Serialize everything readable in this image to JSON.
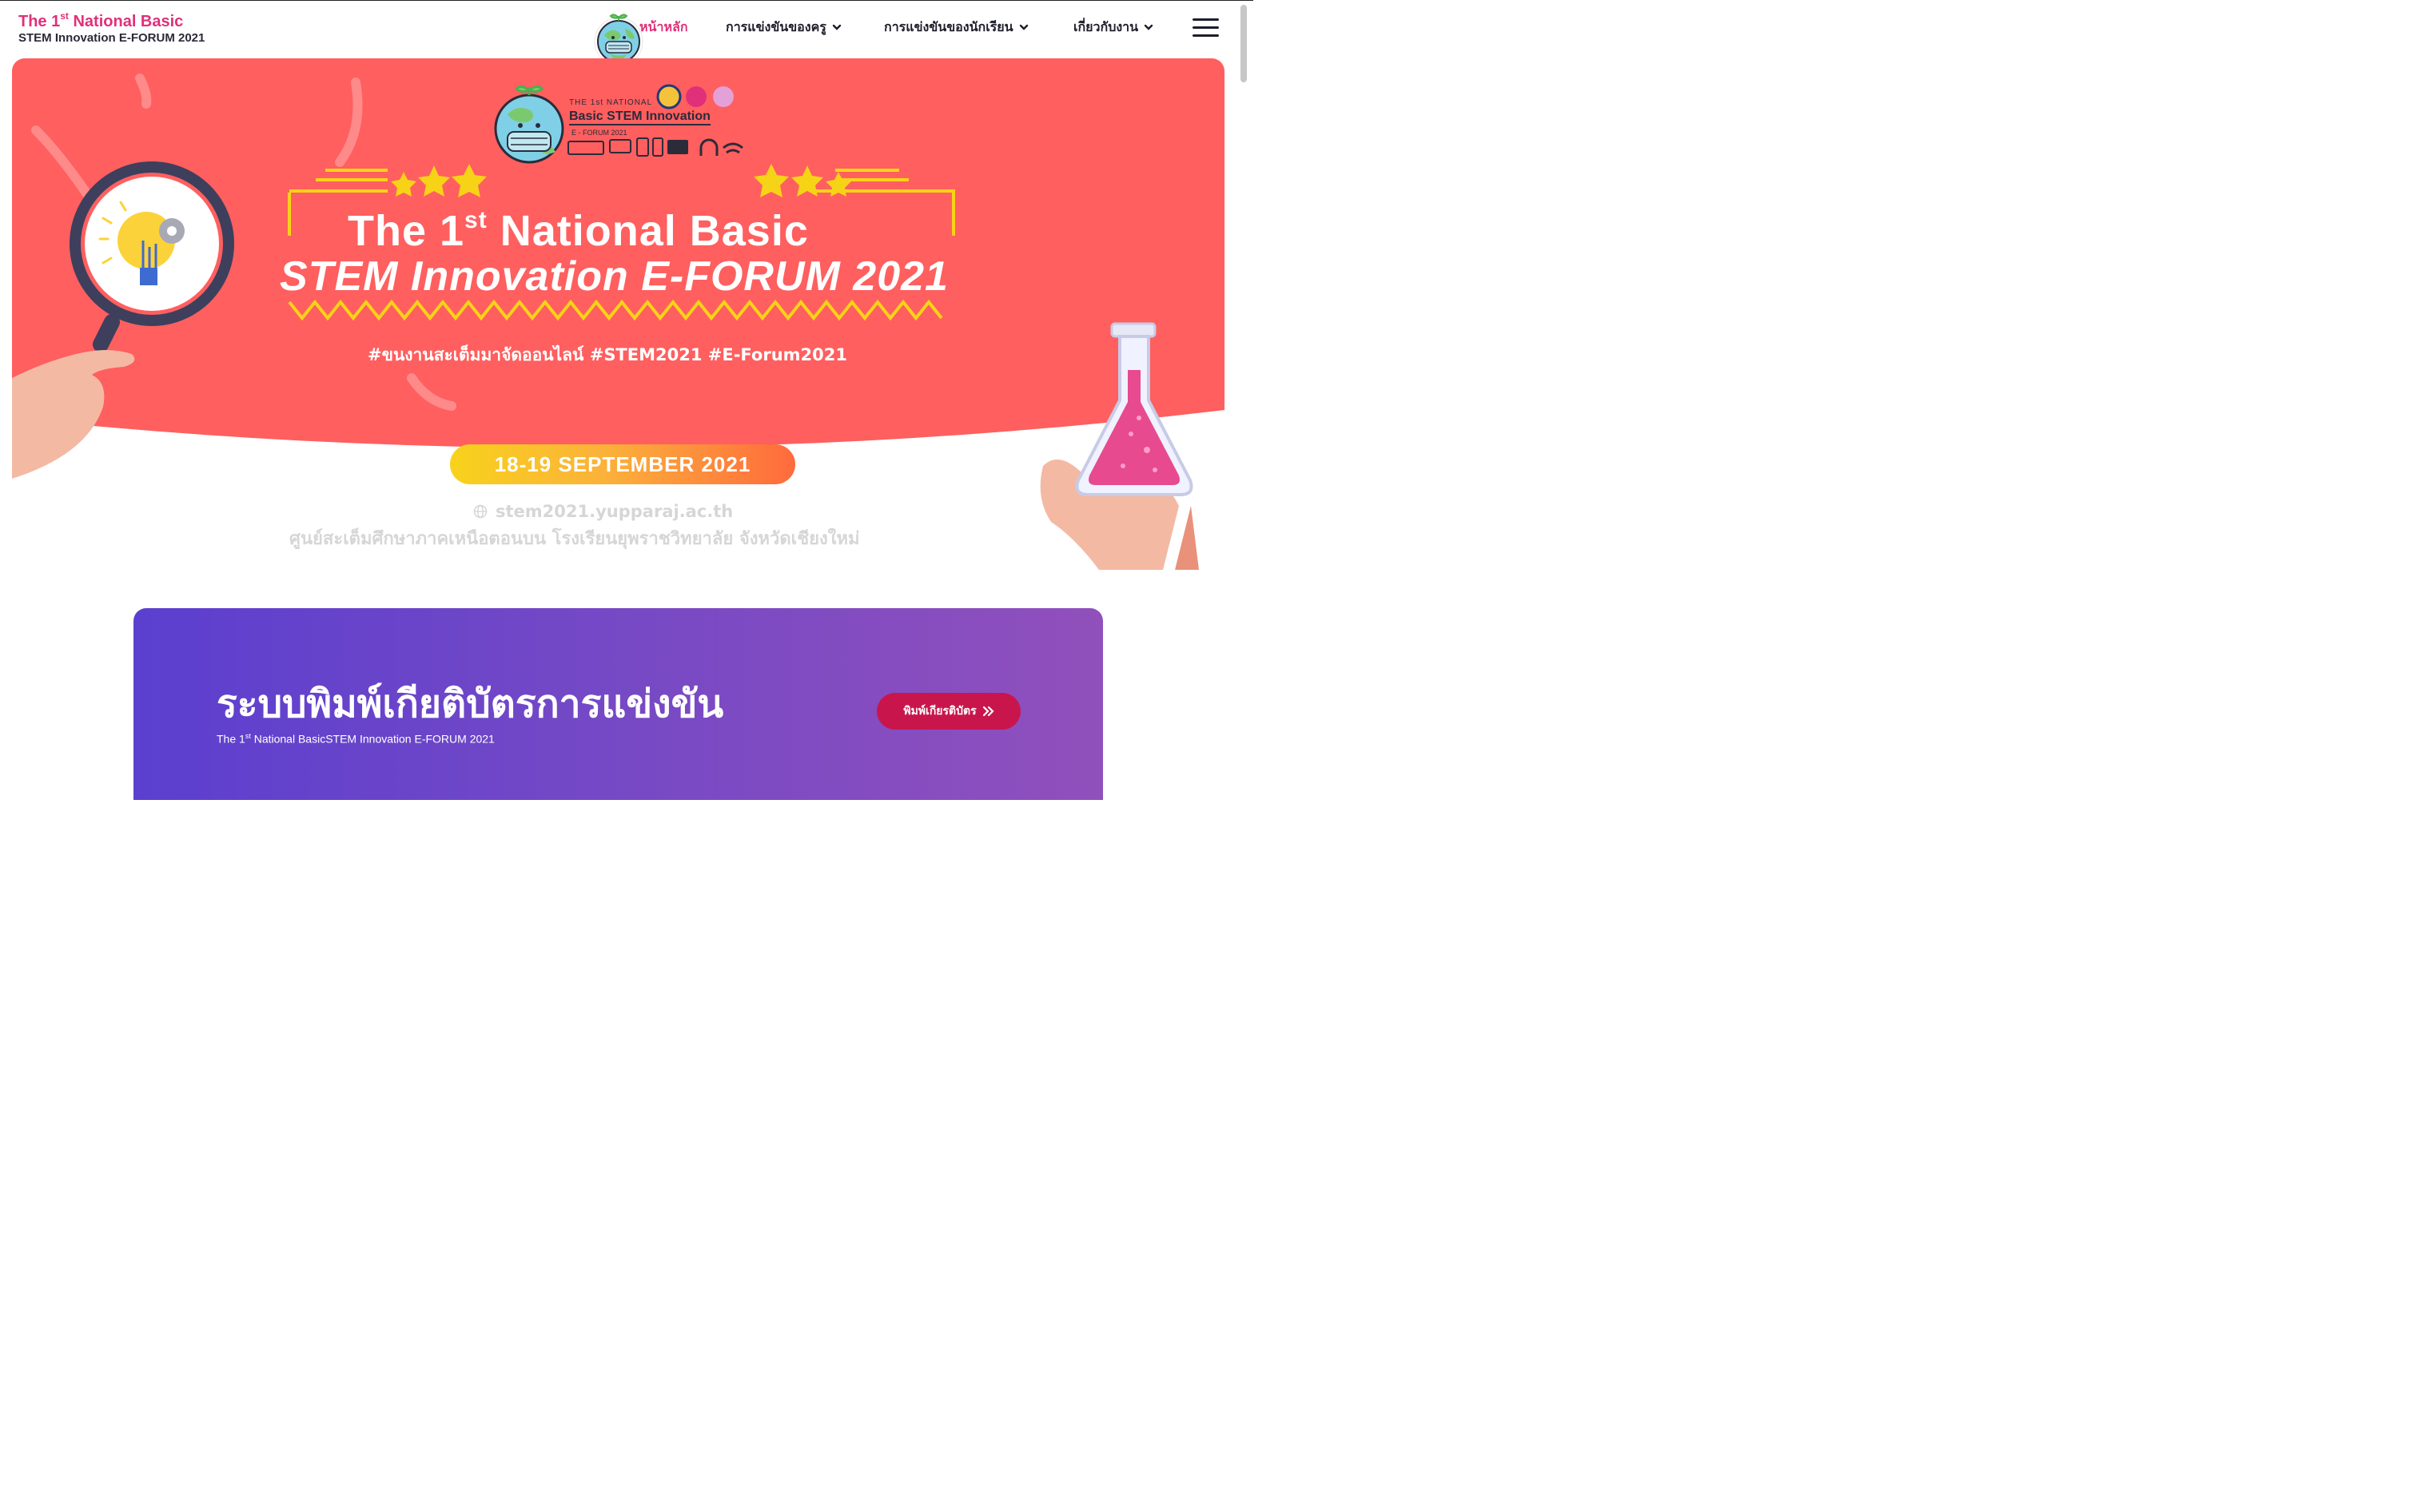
{
  "header": {
    "brand_line1_prefix": "The 1",
    "brand_line1_sup": "st",
    "brand_line1_suffix": " National Basic",
    "brand_line2": "STEM Innovation E-FORUM 2021",
    "nav": [
      {
        "label": "หน้าหลัก",
        "active": true
      },
      {
        "label": "การแข่งขันของครู",
        "dropdown": true
      },
      {
        "label": "การแข่งขันของนักเรียน",
        "dropdown": true
      },
      {
        "label": "เกี่ยวกับงาน",
        "dropdown": true
      }
    ]
  },
  "hero": {
    "logo_top": "THE 1st NATIONAL",
    "logo_title": "Basic STEM Innovation",
    "logo_sub": "E - FORUM 2021",
    "title1_prefix": "The 1",
    "title1_sup": "st",
    "title1_suffix": " National Basic",
    "title2": "STEM Innovation E-FORUM 2021",
    "hashtags": "#ขนงานสะเต็มมาจัดออนไลน์ #STEM2021 #E-Forum2021",
    "date": "18-19 SEPTEMBER 2021",
    "website": "stem2021.yupparaj.ac.th",
    "organizer": "ศูนย์สะเต็มศึกษาภาคเหนือตอนบน โรงเรียนยุพราชวิทยาลัย จังหวัดเชียงใหม่"
  },
  "certificate": {
    "title": "ระบบพิมพ์เกียติบัตรการแข่งขัน",
    "subtitle_prefix": "The 1",
    "subtitle_sup": "st",
    "subtitle_suffix": " National BasicSTEM Innovation E-FORUM 2021",
    "button_label": "พิมพ์เกียรติบัตร"
  },
  "colors": {
    "brand_pink": "#e0307a",
    "hero_red": "#ff5f5f",
    "date_yellow": "#f8d21c",
    "date_orange": "#ff6a3d",
    "cert_purple_start": "#5b3fcf",
    "cert_purple_end": "#9150bc",
    "cert_button": "#c8164c"
  },
  "icons": [
    "earth-mascot-logo-icon",
    "chevron-down-icon",
    "hamburger-menu-icon",
    "globe-icon",
    "double-chevron-right-icon",
    "magnifier-lightbulb-illustration",
    "flask-illustration"
  ]
}
